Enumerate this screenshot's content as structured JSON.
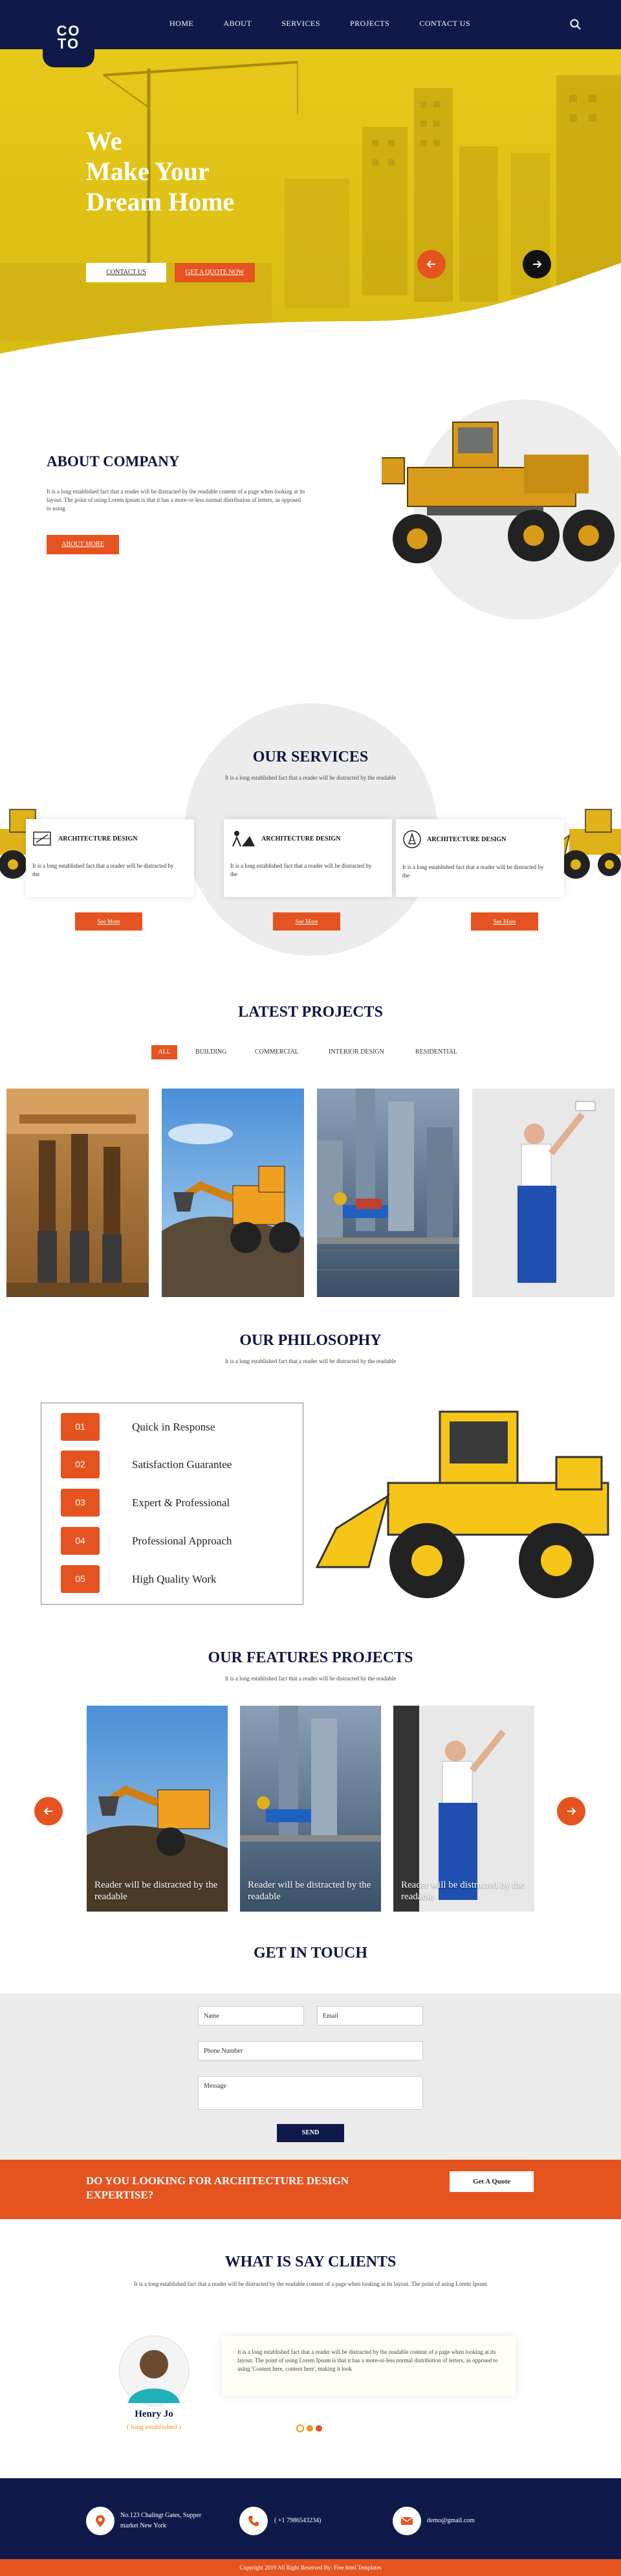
{
  "header": {
    "logo": "CO\nTO",
    "logo_line1": "CO",
    "logo_line2": "TO",
    "nav": [
      "HOME",
      "ABOUT",
      "SERVICES",
      "PROJECTS",
      "CONTACT US"
    ],
    "search_icon": "search-icon"
  },
  "hero": {
    "title_line1": "We",
    "title_line2": "Make Your",
    "title_line3": "Dream Home",
    "contact_btn": "CONTACT US",
    "quote_btn": "GET A QUOTE NOW",
    "prev_icon": "arrow-left-icon",
    "next_icon": "arrow-right-icon"
  },
  "about": {
    "title": "ABOUT COMPANY",
    "text": "It is a long established fact that a reader will be distracted by the readable content of a page when looking at its layout. The point of using Lorem Ipsum is that it has a more-or-less normal distribution of letters, as opposed to using",
    "button": "ABOUT MORE"
  },
  "services": {
    "title": "OUR SERVICES",
    "subtitle": "It is a long established fact that a reader will be distracted by the readable",
    "cards": [
      {
        "title": "ARCHITECTURE DESIGN",
        "text": "It is a long established fact that a reader will be distracted by the",
        "icon": "blueprint-icon",
        "button": "See More"
      },
      {
        "title": "ARCHITECTURE DESIGN",
        "text": "It is a long established fact that a reader will be distracted by the",
        "icon": "worker-icon",
        "button": "See More"
      },
      {
        "title": "ARCHITECTURE DESIGN",
        "text": "It is a long established fact that a reader will be distracted by the",
        "icon": "cone-icon",
        "button": "See More"
      }
    ]
  },
  "projects": {
    "title": "LATEST PROJECTS",
    "filters": [
      "ALL",
      "BUILDING",
      "COMMERCIAL",
      "INTERIOR DESIGN",
      "RESIDENTIAL"
    ]
  },
  "philosophy": {
    "title": "OUR PHILOSOPHY",
    "subtitle": "It is a long established fact that a reader will be distracted by the readable",
    "items": [
      {
        "num": "01",
        "label": "Quick in Response"
      },
      {
        "num": "02",
        "label": "Satisfaction Guarantee"
      },
      {
        "num": "03",
        "label": "Expert & Professional"
      },
      {
        "num": "04",
        "label": "Professional Approach"
      },
      {
        "num": "05",
        "label": "High Quality Work"
      }
    ]
  },
  "features": {
    "title": "OUR FEATURES PROJECTS",
    "subtitle": "It is a long established fact that a reader will be distracted by the readable",
    "captions": [
      "Reader will be distracted by the readable",
      "Reader will be distracted by the readable",
      "Reader will be distracted by the readable"
    ]
  },
  "contact": {
    "title": "GET IN TOUCH",
    "name_placeholder": "Name",
    "email_placeholder": "Email",
    "phone_placeholder": "Phone Number",
    "message_placeholder": "Message",
    "send": "SEND"
  },
  "cta": {
    "text": "DO YOU LOOKING FOR ARCHITECTURE DESIGN EXPERTISE?",
    "text_line1": "DO YOU LOOKING FOR ARCHITECTURE DESIGN",
    "text_line2": "EXPERTISE?",
    "button": "Get A Quote"
  },
  "clients": {
    "title": "WHAT IS SAY CLIENTS",
    "subtitle": "It is a long established fact that a reader will be distracted by the readable content of a page when looking at its layout. The point of using Lorem Ipsum",
    "quote": "It is a long established fact that a reader will be distracted by the readable content of a page when looking at its layout. The point of using Lorem Ipsum is that it has a more-or-less normal distribution of letters, as opposed to using 'Content here, content here', making it look",
    "name": "Henry Jo",
    "role": "( long established )"
  },
  "footer": {
    "address_line1": "No.123 Chalingt Gates, Supper",
    "address_line2": "market New York",
    "phone": "( +1 7986543234)",
    "email": "demo@gmail.com",
    "copyright": "Copyright 2019 All Right Reserved By: Free html Templates"
  },
  "colors": {
    "navy": "#101a4a",
    "accent": "#e55420",
    "hero_yellow": "#e7c81a"
  }
}
